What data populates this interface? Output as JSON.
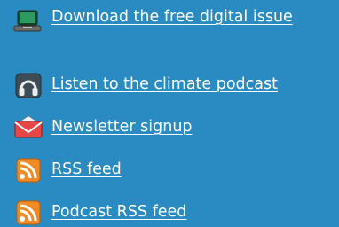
{
  "links": {
    "download": {
      "label": "Download the free digital issue",
      "icon": "laptop-icon"
    },
    "podcast": {
      "label": "Listen to the climate podcast",
      "icon": "headphones-icon"
    },
    "newsletter": {
      "label": "Newsletter signup",
      "icon": "envelope-icon"
    },
    "rss": {
      "label": "RSS feed",
      "icon": "rss-icon"
    },
    "podcast_rss": {
      "label": "Podcast RSS feed",
      "icon": "rss-icon"
    }
  },
  "colors": {
    "background": "#2a8bc2",
    "link_text": "#ffffff",
    "rss_orange": "#f08a24"
  }
}
